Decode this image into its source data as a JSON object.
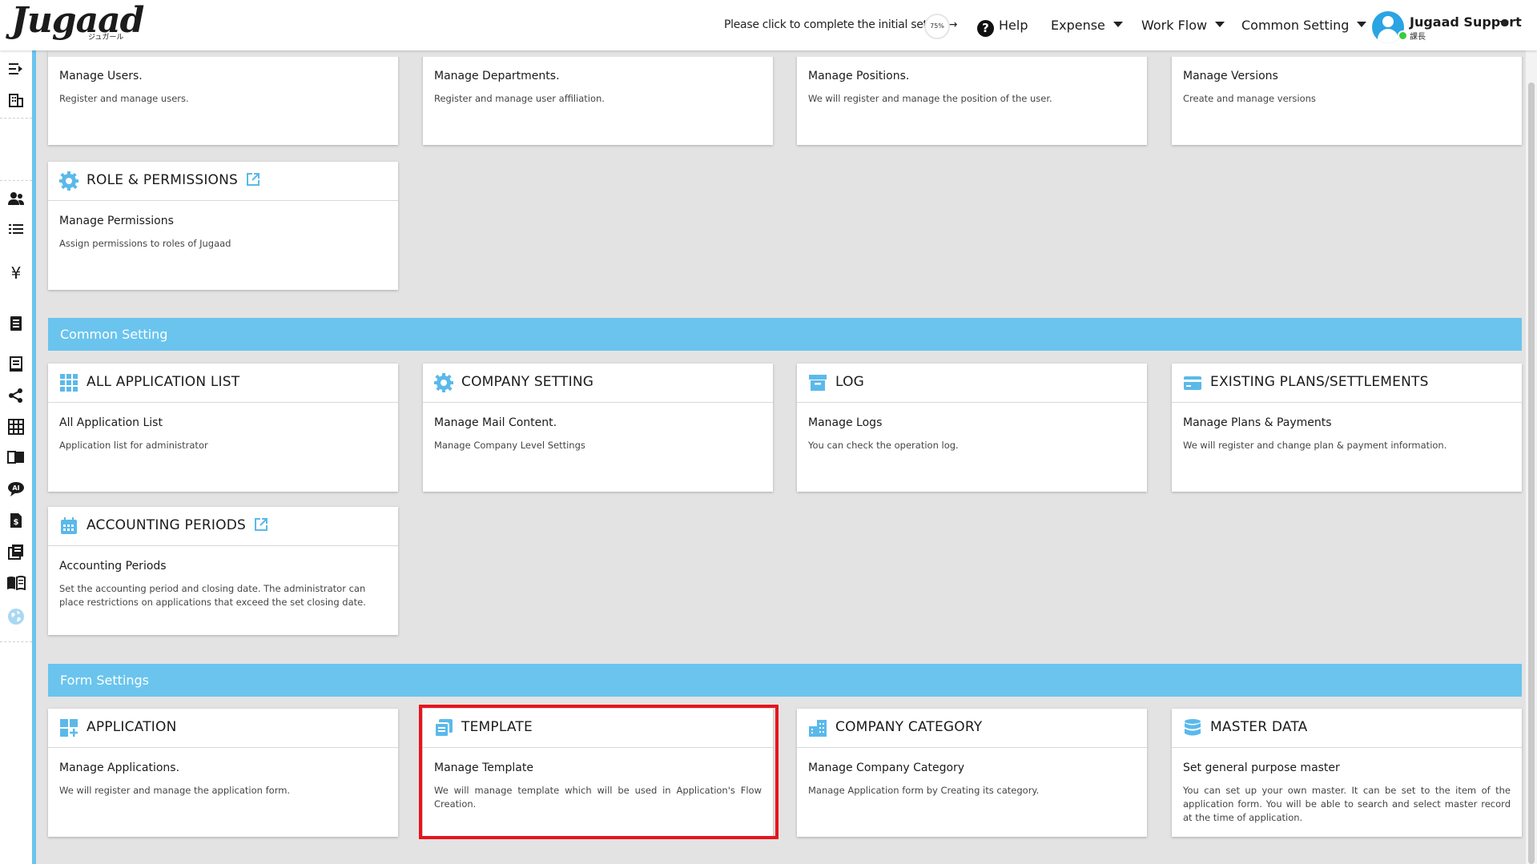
{
  "header": {
    "logo": "Jugaad",
    "logo_sub": "ジュガール",
    "setup_text": "Please click to complete the initial set-up →",
    "setup_progress": "75%",
    "nav": {
      "help": "Help",
      "expense": "Expense",
      "workflow": "Work Flow",
      "common_setting": "Common Setting"
    },
    "user": {
      "name": "Jugaad Support",
      "role": "課長"
    }
  },
  "top_cards": [
    {
      "subtitle": "Manage Users.",
      "description": "Register and manage users."
    },
    {
      "subtitle": "Manage Departments.",
      "description": "Register and manage user affiliation."
    },
    {
      "subtitle": "Manage Positions.",
      "description": "We will register and manage the position of the user."
    },
    {
      "subtitle": "Manage Versions",
      "description": "Create and manage versions"
    }
  ],
  "role_card": {
    "title": "ROLE & PERMISSIONS",
    "subtitle": "Manage Permissions",
    "description": "Assign permissions to roles of Jugaad"
  },
  "sections": {
    "common_setting": "Common Setting",
    "form_settings": "Form Settings"
  },
  "common_cards": [
    {
      "title": "ALL APPLICATION LIST",
      "subtitle": "All Application List",
      "description": "Application list for administrator"
    },
    {
      "title": "COMPANY SETTING",
      "subtitle": "Manage Mail Content.",
      "description": "Manage Company Level Settings"
    },
    {
      "title": "LOG",
      "subtitle": "Manage Logs",
      "description": "You can check the operation log."
    },
    {
      "title": "EXISTING PLANS/SETTLEMENTS",
      "subtitle": "Manage Plans & Payments",
      "description": "We will register and change plan & payment information."
    }
  ],
  "accounting_card": {
    "title": "ACCOUNTING PERIODS",
    "subtitle": "Accounting Periods",
    "description": "Set the accounting period and closing date. The administrator can place restrictions on applications that exceed the set closing date."
  },
  "form_cards": [
    {
      "title": "APPLICATION",
      "subtitle": "Manage Applications.",
      "description": "We will register and manage the application form."
    },
    {
      "title": "TEMPLATE",
      "subtitle": "Manage Template",
      "description": "We will manage template which will be used in Application's Flow Creation."
    },
    {
      "title": "COMPANY CATEGORY",
      "subtitle": "Manage Company Category",
      "description": "Manage Application form by Creating its category."
    },
    {
      "title": "MASTER DATA",
      "subtitle": "Set general purpose master",
      "description": "You can set up your own master. It can be set to the item of the application form. You will be able to search and select master record at the time of application."
    }
  ],
  "colors": {
    "accent": "#6ac4ee",
    "icon_blue": "#5bb9ea",
    "highlight": "#e8141c"
  },
  "sidebar_icons": [
    "menu-expand-icon",
    "building-icon",
    "users-icon",
    "list-icon",
    "yen-icon",
    "document-icon",
    "receipt-icon",
    "share-icon",
    "table-icon",
    "book-icon",
    "ai-chat-icon",
    "invoice-icon",
    "report-icon",
    "manual-icon",
    "globe-icon"
  ]
}
